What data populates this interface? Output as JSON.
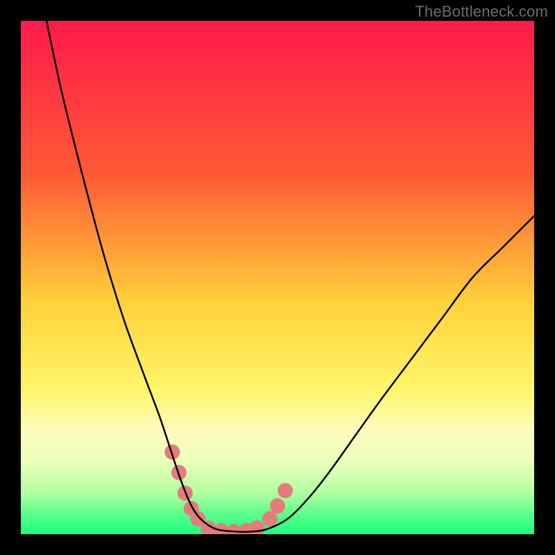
{
  "watermark": "TheBottleneck.com",
  "chart_data": {
    "type": "line",
    "title": "",
    "xlabel": "",
    "ylabel": "",
    "xlim": [
      0,
      100
    ],
    "ylim": [
      0,
      100
    ],
    "background_gradient": {
      "stops": [
        {
          "offset": 0.0,
          "color": "#ff1a4b"
        },
        {
          "offset": 0.3,
          "color": "#ff5a35"
        },
        {
          "offset": 0.55,
          "color": "#ffd23a"
        },
        {
          "offset": 0.72,
          "color": "#fff66a"
        },
        {
          "offset": 0.8,
          "color": "#fffcc0"
        },
        {
          "offset": 0.86,
          "color": "#e9ffb8"
        },
        {
          "offset": 0.92,
          "color": "#b0ffa0"
        },
        {
          "offset": 0.96,
          "color": "#5cff8c"
        },
        {
          "offset": 1.0,
          "color": "#1aff7a"
        }
      ]
    },
    "series": [
      {
        "name": "bottleneck-curve",
        "color": "#000000",
        "width": 2.5,
        "x": [
          5,
          8,
          12,
          16,
          20,
          24,
          27,
          29,
          31,
          33,
          35,
          38,
          42,
          45,
          48,
          52,
          56,
          60,
          65,
          70,
          76,
          82,
          88,
          94,
          100
        ],
        "values": [
          100,
          86,
          70,
          55,
          42,
          31,
          23,
          17,
          11,
          6,
          3,
          1,
          0.5,
          0.5,
          1,
          3,
          7,
          12,
          19,
          26,
          34,
          42,
          50,
          56,
          62
        ]
      }
    ],
    "markers": {
      "name": "highlight-points",
      "color": "#e67b7c",
      "radius_px": 11,
      "points": [
        {
          "x": 29.5,
          "y": 16
        },
        {
          "x": 30.8,
          "y": 12
        },
        {
          "x": 32.0,
          "y": 8
        },
        {
          "x": 33.2,
          "y": 5
        },
        {
          "x": 34.5,
          "y": 3
        },
        {
          "x": 36.5,
          "y": 1.2
        },
        {
          "x": 39.0,
          "y": 0.7
        },
        {
          "x": 41.5,
          "y": 0.5
        },
        {
          "x": 44.0,
          "y": 0.7
        },
        {
          "x": 46.0,
          "y": 1.2
        },
        {
          "x": 48.5,
          "y": 3
        },
        {
          "x": 50.0,
          "y": 5.5
        },
        {
          "x": 51.5,
          "y": 8.5
        }
      ]
    }
  }
}
